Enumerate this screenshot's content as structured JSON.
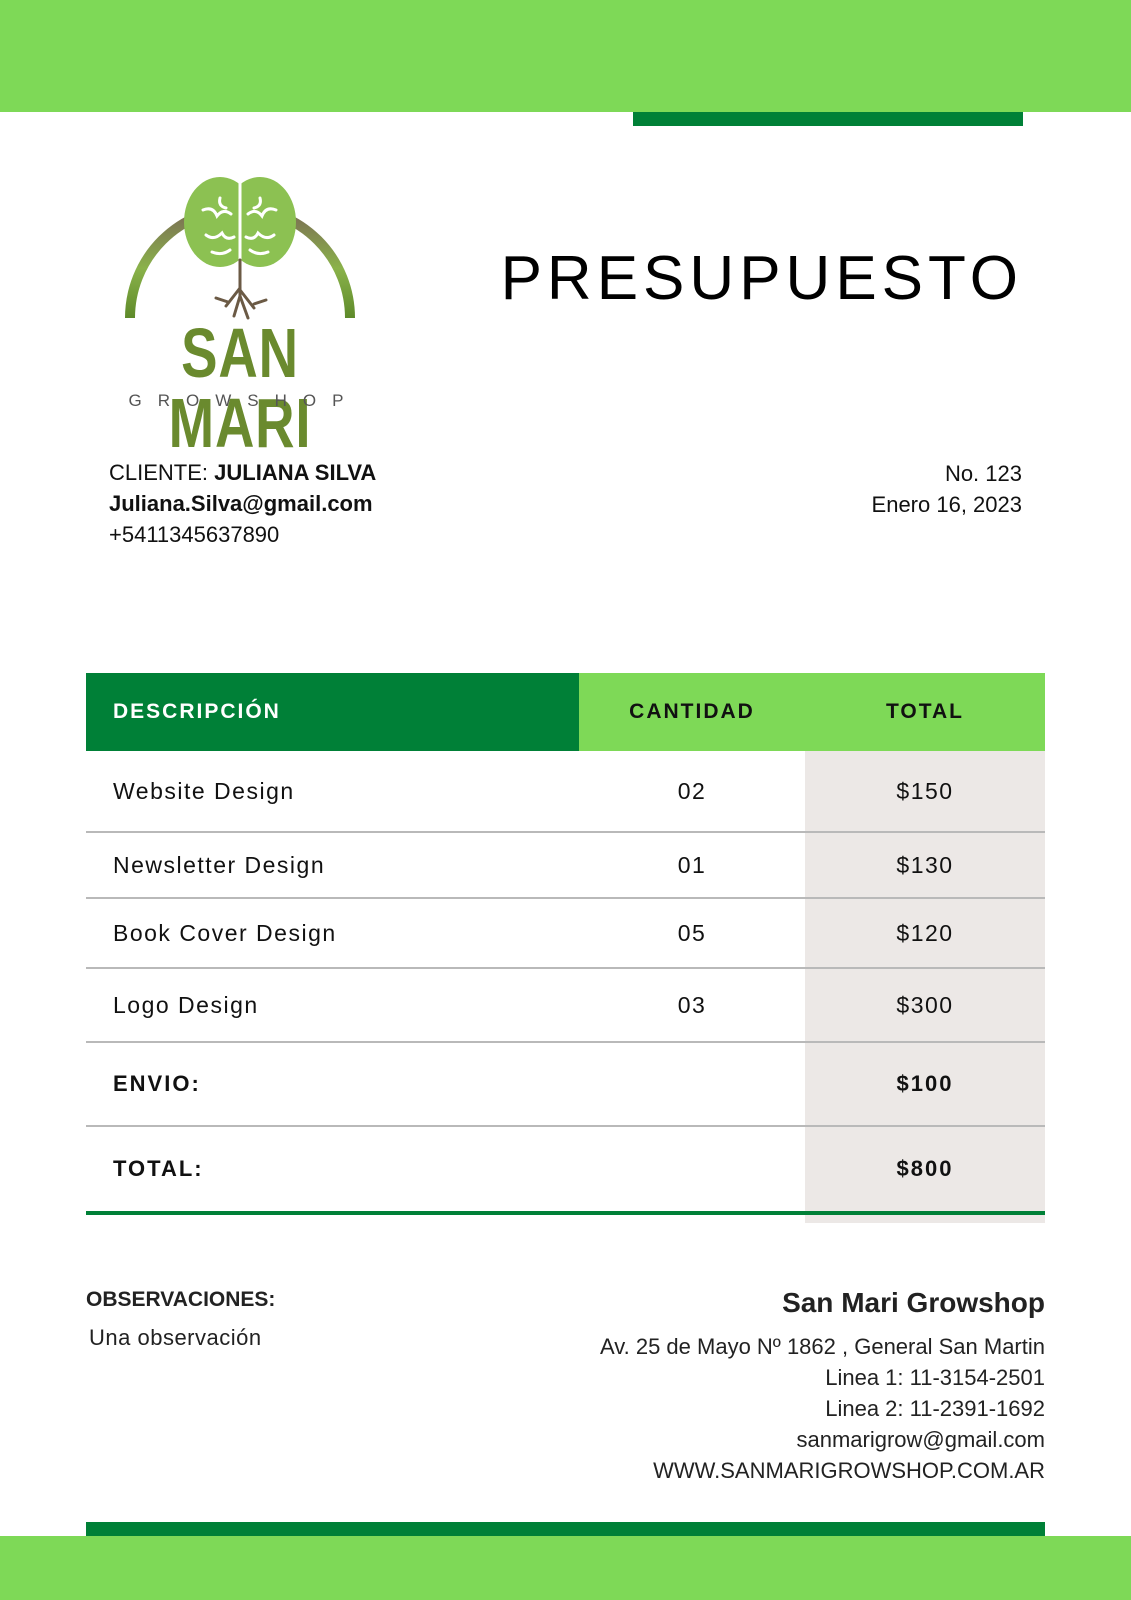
{
  "logo": {
    "text_main": "SAN MARI",
    "text_sub": "GROWSHOP",
    "icon": "tree-brain-icon"
  },
  "document": {
    "title": "PRESUPUESTO"
  },
  "client": {
    "label": "CLIENTE:",
    "name": "JULIANA SILVA",
    "email": "Juliana.Silva@gmail.com",
    "phone": "+5411345637890"
  },
  "meta": {
    "number": "No. 123",
    "date": "Enero 16, 2023"
  },
  "table": {
    "headers": {
      "description": "DESCRIPCIÓN",
      "quantity": "CANTIDAD",
      "total": "TOTAL"
    },
    "rows": [
      {
        "description": "Website Design",
        "quantity": "02",
        "total": "$150"
      },
      {
        "description": "Newsletter Design",
        "quantity": "01",
        "total": "$130"
      },
      {
        "description": "Book Cover Design",
        "quantity": "05",
        "total": "$120"
      },
      {
        "description": "Logo Design",
        "quantity": "03",
        "total": "$300"
      }
    ],
    "shipping": {
      "label": "ENVIO:",
      "value": "$100"
    },
    "grand_total": {
      "label": "TOTAL:",
      "value": "$800"
    }
  },
  "observations": {
    "label": "OBSERVACIONES:",
    "text": "Una observación"
  },
  "company": {
    "name": "San Mari Growshop",
    "address": "Av. 25 de Mayo Nº 1862 , General San Martin",
    "line1": "Linea 1: 11-3154-2501",
    "line2": "Linea 2: 11-2391-1692",
    "email": "sanmarigrow@gmail.com",
    "website": "WWW.SANMARIGROWSHOP.COM.AR"
  },
  "colors": {
    "light_green": "#7ed957",
    "dark_green": "#008037",
    "grey_column": "#ece8e6"
  }
}
